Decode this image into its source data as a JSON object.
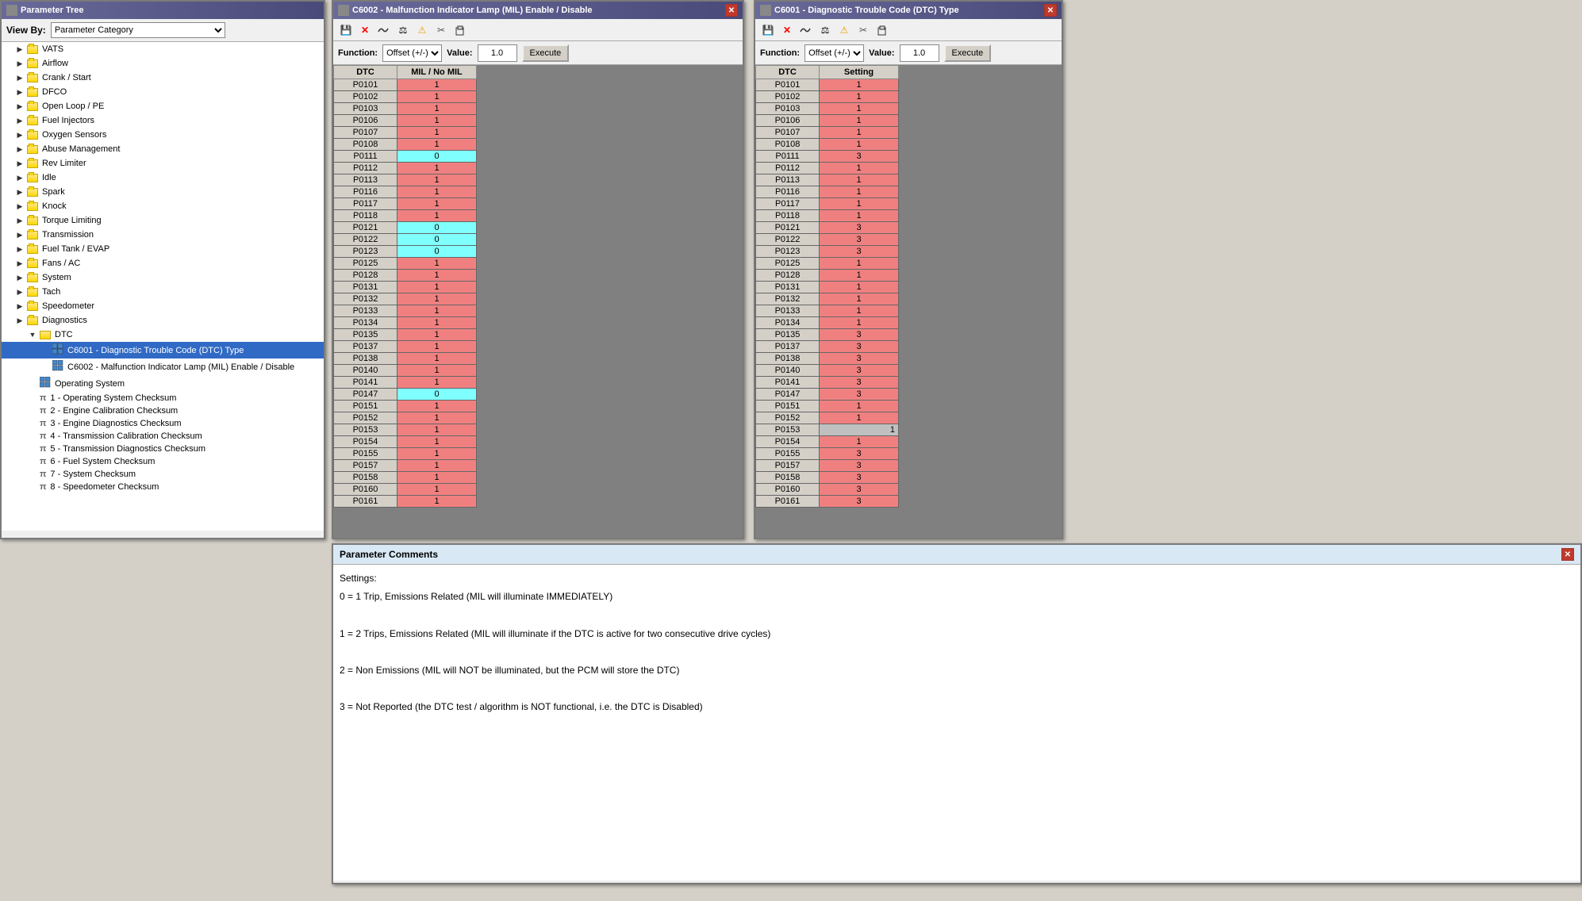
{
  "paramTree": {
    "title": "Parameter Tree",
    "viewByLabel": "View By:",
    "viewByValue": "Parameter Category",
    "items": [
      {
        "id": "vats",
        "label": "VATS",
        "indent": 1,
        "type": "folder",
        "expanded": false
      },
      {
        "id": "airflow",
        "label": "Airflow",
        "indent": 1,
        "type": "folder",
        "expanded": false
      },
      {
        "id": "crankstart",
        "label": "Crank / Start",
        "indent": 1,
        "type": "folder",
        "expanded": false
      },
      {
        "id": "dfco",
        "label": "DFCO",
        "indent": 1,
        "type": "folder",
        "expanded": false
      },
      {
        "id": "openloop",
        "label": "Open Loop / PE",
        "indent": 1,
        "type": "folder",
        "expanded": false
      },
      {
        "id": "fuelinjectors",
        "label": "Fuel Injectors",
        "indent": 1,
        "type": "folder",
        "expanded": false
      },
      {
        "id": "oxygensensors",
        "label": "Oxygen Sensors",
        "indent": 1,
        "type": "folder",
        "expanded": false
      },
      {
        "id": "abusemanagement",
        "label": "Abuse Management",
        "indent": 1,
        "type": "folder",
        "expanded": false
      },
      {
        "id": "revlimiter",
        "label": "Rev Limiter",
        "indent": 1,
        "type": "folder",
        "expanded": false
      },
      {
        "id": "idle",
        "label": "Idle",
        "indent": 1,
        "type": "folder",
        "expanded": false
      },
      {
        "id": "spark",
        "label": "Spark",
        "indent": 1,
        "type": "folder",
        "expanded": false
      },
      {
        "id": "knock",
        "label": "Knock",
        "indent": 1,
        "type": "folder",
        "expanded": false
      },
      {
        "id": "torquelimiting",
        "label": "Torque Limiting",
        "indent": 1,
        "type": "folder",
        "expanded": false
      },
      {
        "id": "transmission",
        "label": "Transmission",
        "indent": 1,
        "type": "folder",
        "expanded": false
      },
      {
        "id": "fueltank",
        "label": "Fuel Tank / EVAP",
        "indent": 1,
        "type": "folder",
        "expanded": false
      },
      {
        "id": "fansac",
        "label": "Fans / AC",
        "indent": 1,
        "type": "folder",
        "expanded": false
      },
      {
        "id": "system",
        "label": "System",
        "indent": 1,
        "type": "folder",
        "expanded": false
      },
      {
        "id": "tach",
        "label": "Tach",
        "indent": 1,
        "type": "folder",
        "expanded": false
      },
      {
        "id": "speedometer",
        "label": "Speedometer",
        "indent": 1,
        "type": "folder",
        "expanded": false
      },
      {
        "id": "diagnostics",
        "label": "Diagnostics",
        "indent": 1,
        "type": "folder",
        "expanded": false
      },
      {
        "id": "dtc",
        "label": "DTC",
        "indent": 2,
        "type": "folder",
        "expanded": true
      },
      {
        "id": "c6001",
        "label": "C6001 - Diagnostic Trouble Code (DTC) Type",
        "indent": 3,
        "type": "grid",
        "selected": true
      },
      {
        "id": "c6002",
        "label": "C6002 - Malfunction Indicator Lamp (MIL) Enable / Disable",
        "indent": 3,
        "type": "grid",
        "selected": false
      },
      {
        "id": "operatingsystem",
        "label": "Operating System",
        "indent": 2,
        "type": "grid",
        "selected": false
      },
      {
        "id": "cksum1",
        "label": "1 - Operating System Checksum",
        "indent": 2,
        "type": "pi"
      },
      {
        "id": "cksum2",
        "label": "2 - Engine Calibration Checksum",
        "indent": 2,
        "type": "pi"
      },
      {
        "id": "cksum3",
        "label": "3 - Engine Diagnostics Checksum",
        "indent": 2,
        "type": "pi"
      },
      {
        "id": "cksum4",
        "label": "4 - Transmission Calibration Checksum",
        "indent": 2,
        "type": "pi"
      },
      {
        "id": "cksum5",
        "label": "5 - Transmission Diagnostics Checksum",
        "indent": 2,
        "type": "pi"
      },
      {
        "id": "cksum6",
        "label": "6 - Fuel System Checksum",
        "indent": 2,
        "type": "pi"
      },
      {
        "id": "cksum7",
        "label": "7 - System Checksum",
        "indent": 2,
        "type": "pi"
      },
      {
        "id": "cksum8",
        "label": "8 - Speedometer Checksum",
        "indent": 2,
        "type": "pi"
      }
    ]
  },
  "milPanel": {
    "title": "C6002 - Malfunction Indicator Lamp (MIL) Enable / Disable",
    "functionLabel": "Function:",
    "functionValue": "Offset (+/-)",
    "valueLabel": "Value:",
    "valueInput": "1.0",
    "executeLabel": "Execute",
    "colDTC": "DTC",
    "colMIL": "MIL / No MIL",
    "rows": [
      {
        "dtc": "P0101",
        "val": "1",
        "color": "red"
      },
      {
        "dtc": "P0102",
        "val": "1",
        "color": "red"
      },
      {
        "dtc": "P0103",
        "val": "1",
        "color": "red"
      },
      {
        "dtc": "P0106",
        "val": "1",
        "color": "red"
      },
      {
        "dtc": "P0107",
        "val": "1",
        "color": "red"
      },
      {
        "dtc": "P0108",
        "val": "1",
        "color": "red"
      },
      {
        "dtc": "P0111",
        "val": "0",
        "color": "cyan"
      },
      {
        "dtc": "P0112",
        "val": "1",
        "color": "red"
      },
      {
        "dtc": "P0113",
        "val": "1",
        "color": "red"
      },
      {
        "dtc": "P0116",
        "val": "1",
        "color": "red"
      },
      {
        "dtc": "P0117",
        "val": "1",
        "color": "red"
      },
      {
        "dtc": "P0118",
        "val": "1",
        "color": "red"
      },
      {
        "dtc": "P0121",
        "val": "0",
        "color": "cyan"
      },
      {
        "dtc": "P0122",
        "val": "0",
        "color": "cyan"
      },
      {
        "dtc": "P0123",
        "val": "0",
        "color": "cyan"
      },
      {
        "dtc": "P0125",
        "val": "1",
        "color": "red"
      },
      {
        "dtc": "P0128",
        "val": "1",
        "color": "red"
      },
      {
        "dtc": "P0131",
        "val": "1",
        "color": "red"
      },
      {
        "dtc": "P0132",
        "val": "1",
        "color": "red"
      },
      {
        "dtc": "P0133",
        "val": "1",
        "color": "red"
      },
      {
        "dtc": "P0134",
        "val": "1",
        "color": "red"
      },
      {
        "dtc": "P0135",
        "val": "1",
        "color": "red"
      },
      {
        "dtc": "P0137",
        "val": "1",
        "color": "red"
      },
      {
        "dtc": "P0138",
        "val": "1",
        "color": "red"
      },
      {
        "dtc": "P0140",
        "val": "1",
        "color": "red"
      },
      {
        "dtc": "P0141",
        "val": "1",
        "color": "red"
      },
      {
        "dtc": "P0147",
        "val": "0",
        "color": "cyan"
      },
      {
        "dtc": "P0151",
        "val": "1",
        "color": "red"
      },
      {
        "dtc": "P0152",
        "val": "1",
        "color": "red"
      },
      {
        "dtc": "P0153",
        "val": "1",
        "color": "red"
      },
      {
        "dtc": "P0154",
        "val": "1",
        "color": "red"
      },
      {
        "dtc": "P0155",
        "val": "1",
        "color": "red"
      },
      {
        "dtc": "P0157",
        "val": "1",
        "color": "red"
      },
      {
        "dtc": "P0158",
        "val": "1",
        "color": "red"
      },
      {
        "dtc": "P0160",
        "val": "1",
        "color": "red"
      },
      {
        "dtc": "P0161",
        "val": "1",
        "color": "red"
      }
    ]
  },
  "dtcPanel": {
    "title": "C6001 - Diagnostic Trouble Code (DTC) Type",
    "functionLabel": "Function:",
    "functionValue": "Offset (+/-)",
    "valueLabel": "Value:",
    "valueInput": "1.0",
    "executeLabel": "Execute",
    "colDTC": "DTC",
    "colSetting": "Setting",
    "rows": [
      {
        "dtc": "P0101",
        "val": "1",
        "color": "red"
      },
      {
        "dtc": "P0102",
        "val": "1",
        "color": "red"
      },
      {
        "dtc": "P0103",
        "val": "1",
        "color": "red"
      },
      {
        "dtc": "P0106",
        "val": "1",
        "color": "red"
      },
      {
        "dtc": "P0107",
        "val": "1",
        "color": "red"
      },
      {
        "dtc": "P0108",
        "val": "1",
        "color": "red"
      },
      {
        "dtc": "P0111",
        "val": "3",
        "color": "red"
      },
      {
        "dtc": "P0112",
        "val": "1",
        "color": "red"
      },
      {
        "dtc": "P0113",
        "val": "1",
        "color": "red"
      },
      {
        "dtc": "P0116",
        "val": "1",
        "color": "red"
      },
      {
        "dtc": "P0117",
        "val": "1",
        "color": "red"
      },
      {
        "dtc": "P0118",
        "val": "1",
        "color": "red"
      },
      {
        "dtc": "P0121",
        "val": "3",
        "color": "red"
      },
      {
        "dtc": "P0122",
        "val": "3",
        "color": "red"
      },
      {
        "dtc": "P0123",
        "val": "3",
        "color": "red"
      },
      {
        "dtc": "P0125",
        "val": "1",
        "color": "red"
      },
      {
        "dtc": "P0128",
        "val": "1",
        "color": "red"
      },
      {
        "dtc": "P0131",
        "val": "1",
        "color": "red"
      },
      {
        "dtc": "P0132",
        "val": "1",
        "color": "red"
      },
      {
        "dtc": "P0133",
        "val": "1",
        "color": "red"
      },
      {
        "dtc": "P0134",
        "val": "1",
        "color": "red"
      },
      {
        "dtc": "P0135",
        "val": "3",
        "color": "red"
      },
      {
        "dtc": "P0137",
        "val": "3",
        "color": "red"
      },
      {
        "dtc": "P0138",
        "val": "3",
        "color": "red"
      },
      {
        "dtc": "P0140",
        "val": "3",
        "color": "red"
      },
      {
        "dtc": "P0141",
        "val": "3",
        "color": "red"
      },
      {
        "dtc": "P0147",
        "val": "3",
        "color": "red"
      },
      {
        "dtc": "P0151",
        "val": "1",
        "color": "red"
      },
      {
        "dtc": "P0152",
        "val": "1",
        "color": "red"
      },
      {
        "dtc": "P0153",
        "val": "1",
        "color": "gray"
      },
      {
        "dtc": "P0154",
        "val": "1",
        "color": "red"
      },
      {
        "dtc": "P0155",
        "val": "3",
        "color": "red"
      },
      {
        "dtc": "P0157",
        "val": "3",
        "color": "red"
      },
      {
        "dtc": "P0158",
        "val": "3",
        "color": "red"
      },
      {
        "dtc": "P0160",
        "val": "3",
        "color": "red"
      },
      {
        "dtc": "P0161",
        "val": "3",
        "color": "red"
      }
    ]
  },
  "commentsPanel": {
    "title": "Parameter Comments",
    "lines": [
      "Settings:",
      "0 = 1 Trip, Emissions Related (MIL will illuminate IMMEDIATELY)",
      "",
      "1 = 2 Trips, Emissions Related (MIL will illuminate if the DTC is active for two consecutive drive cycles)",
      "",
      "2 = Non Emissions (MIL will NOT be illuminated, but the PCM will store the DTC)",
      "",
      "3 = Not Reported (the DTC test / algorithm is NOT functional, i.e. the DTC is Disabled)"
    ]
  },
  "toolbar": {
    "save": "💾",
    "delete": "✕",
    "wave": "~",
    "scale": "⚖",
    "warning": "⚠",
    "cut": "✂",
    "paste": "⎘"
  }
}
